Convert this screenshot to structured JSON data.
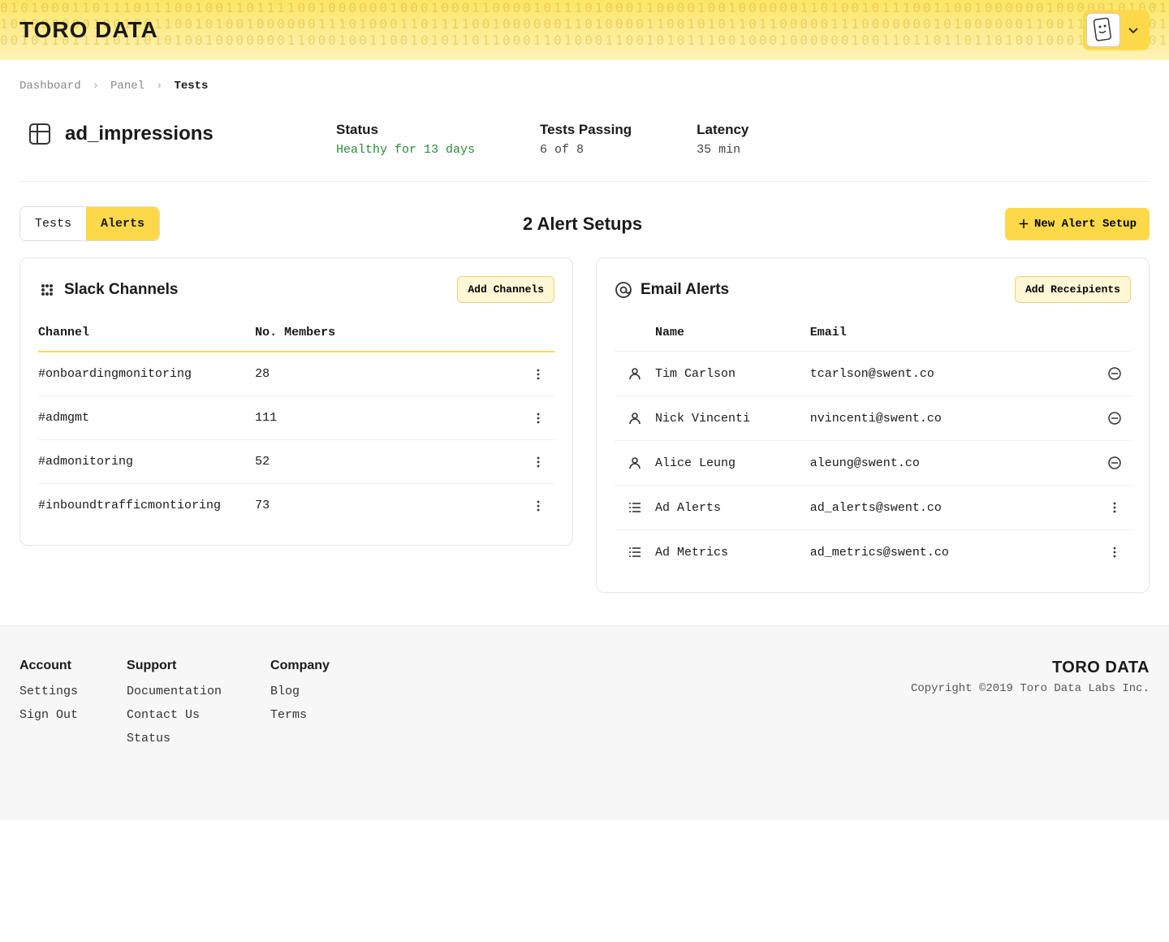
{
  "brand": "TORO DATA",
  "breadcrumb": {
    "a": "Dashboard",
    "b": "Panel",
    "c": "Tests"
  },
  "page": {
    "title": "ad_impressions",
    "status_label": "Status",
    "status_value": "Healthy for 13 days",
    "passing_label": "Tests Passing",
    "passing_value": "6 of 8",
    "latency_label": "Latency",
    "latency_value": "35 min"
  },
  "tabs": {
    "tests": "Tests",
    "alerts": "Alerts"
  },
  "section_heading": "2 Alert Setups",
  "new_alert_btn": "New Alert Setup",
  "slack": {
    "title": "Slack Channels",
    "add_btn": "Add Channels",
    "col_channel": "Channel",
    "col_members": "No. Members",
    "rows": [
      {
        "channel": "#onboardingmonitoring",
        "members": "28"
      },
      {
        "channel": "#admgmt",
        "members": "111"
      },
      {
        "channel": "#admonitoring",
        "members": "52"
      },
      {
        "channel": "#inboundtrafficmontioring",
        "members": "73"
      }
    ]
  },
  "email": {
    "title": "Email Alerts",
    "add_btn": "Add Receipients",
    "col_name": "Name",
    "col_email": "Email",
    "rows": [
      {
        "type": "person",
        "name": "Tim Carlson",
        "email": "tcarlson@swent.co",
        "action": "remove"
      },
      {
        "type": "person",
        "name": "Nick Vincenti",
        "email": "nvincenti@swent.co",
        "action": "remove"
      },
      {
        "type": "person",
        "name": "Alice Leung",
        "email": "aleung@swent.co",
        "action": "remove"
      },
      {
        "type": "list",
        "name": "Ad Alerts",
        "email": "ad_alerts@swent.co",
        "action": "more"
      },
      {
        "type": "list",
        "name": "Ad Metrics",
        "email": "ad_metrics@swent.co",
        "action": "more"
      }
    ]
  },
  "footer": {
    "account": {
      "h": "Account",
      "links": [
        "Settings",
        "Sign Out"
      ]
    },
    "support": {
      "h": "Support",
      "links": [
        "Documentation",
        "Contact Us",
        "Status"
      ]
    },
    "company": {
      "h": "Company",
      "links": [
        "Blog",
        "Terms"
      ]
    },
    "copyright": "Copyright ©2019 Toro Data Labs Inc."
  }
}
